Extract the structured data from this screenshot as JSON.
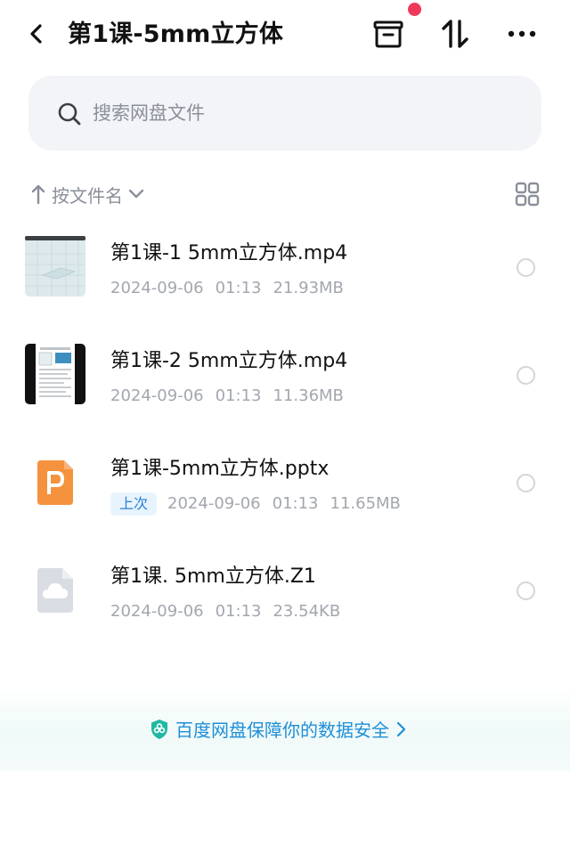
{
  "header": {
    "title": "第1课-5mm立方体",
    "back_icon": "chevron-left-icon",
    "archive_icon": "archive-box-icon",
    "sort_icon": "up-down-arrows-icon",
    "more_icon": "more-dots-icon",
    "notification_dot_color": "#f0395a"
  },
  "search": {
    "placeholder": "搜索网盘文件",
    "icon": "search-icon"
  },
  "sort": {
    "label": "按文件名",
    "direction_icon": "arrow-up-icon",
    "dropdown_icon": "chevron-down-icon",
    "view_icon": "grid-view-icon"
  },
  "files": [
    {
      "name": "第1课-1  5mm立方体.mp4",
      "date": "2024-09-06",
      "time": "01:13",
      "size": "21.93MB",
      "badge": "",
      "type_icon": "video-thumbnail"
    },
    {
      "name": "第1课-2  5mm立方体.mp4",
      "date": "2024-09-06",
      "time": "01:13",
      "size": "11.36MB",
      "badge": "",
      "type_icon": "video-thumbnail"
    },
    {
      "name": "第1课-5mm立方体.pptx",
      "date": "2024-09-06",
      "time": "01:13",
      "size": "11.65MB",
      "badge": "上次",
      "type_icon": "ppt-file-icon"
    },
    {
      "name": "第1课. 5mm立方体.Z1",
      "date": "2024-09-06",
      "time": "01:13",
      "size": "23.54KB",
      "badge": "",
      "type_icon": "cloud-file-icon"
    }
  ],
  "footer": {
    "text": "百度网盘保障你的数据安全",
    "icon": "shield-icon",
    "accent_color": "#1f8fd8"
  },
  "colors": {
    "accent_orange": "#f5923e",
    "badge_blue": "#2a7fd4",
    "meta_gray": "#a3a7ae"
  }
}
